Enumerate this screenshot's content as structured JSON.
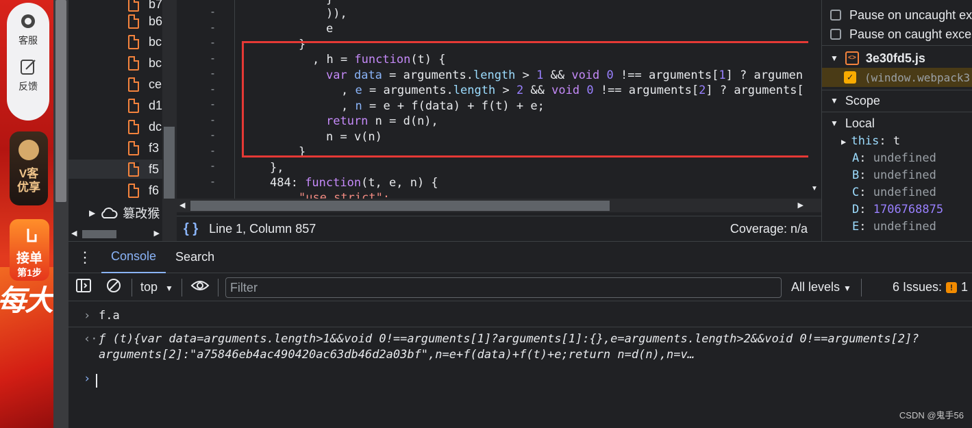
{
  "sidebar": {
    "service_label": "客服",
    "feedback_label": "反馈",
    "vip_label": "V客优享",
    "vip_line1": "V客",
    "vip_line2": "优享",
    "order_line1": "接单",
    "order_line2": "第1步",
    "promo_text": "每大"
  },
  "file_tree": {
    "files": [
      "b7",
      "b6",
      "bc",
      "bc",
      "ce",
      "d1",
      "dc",
      "f3",
      "f5",
      "f6"
    ],
    "folder_label": "篡改猴"
  },
  "editor": {
    "lines": [
      {
        "gutter": "",
        "text": "}"
      },
      {
        "gutter": "-",
        "text": ")),"
      },
      {
        "gutter": "-",
        "text": "e"
      },
      {
        "gutter": "-",
        "text": "}"
      },
      {
        "gutter": "-",
        "text": ", h = function(t) {"
      },
      {
        "gutter": "-",
        "text": "var data = arguments.length > 1 && void 0 !== arguments[1] ? argumen"
      },
      {
        "gutter": "-",
        "text": ", e = arguments.length > 2 && void 0 !== arguments[2] ? arguments["
      },
      {
        "gutter": "-",
        "text": ", n = e + f(data) + f(t) + e;"
      },
      {
        "gutter": "-",
        "text": "return n = d(n),"
      },
      {
        "gutter": "-",
        "text": "n = v(n)"
      },
      {
        "gutter": "-",
        "text": "}"
      },
      {
        "gutter": "-",
        "text": "},"
      },
      {
        "gutter": "-",
        "text": "484: function(t, e, n) {"
      },
      {
        "gutter": "",
        "text": "\"use strict\";"
      }
    ],
    "status_position": "Line 1, Column 857",
    "status_coverage": "Coverage: n/a",
    "braces_icon": "{ }"
  },
  "debugger": {
    "pause_uncaught": "Pause on uncaught ex",
    "pause_caught": "Pause on caught excep",
    "callstack_file": "3e30fd5.js",
    "callstack_frame": "(window.webpack3",
    "scope_label": "Scope",
    "local_label": "Local",
    "this_key": "this",
    "this_val": "t",
    "vars": [
      {
        "key": "A",
        "value": "undefined",
        "is_num": false
      },
      {
        "key": "B",
        "value": "undefined",
        "is_num": false
      },
      {
        "key": "C",
        "value": "undefined",
        "is_num": false
      },
      {
        "key": "D",
        "value": "1706768875",
        "is_num": true
      },
      {
        "key": "E",
        "value": "undefined",
        "is_num": false
      }
    ]
  },
  "drawer": {
    "tabs": [
      "Console",
      "Search"
    ],
    "active_tab": "Console",
    "context": "top",
    "filter_placeholder": "Filter",
    "levels": "All levels",
    "issues_label": "6 Issues:",
    "issues_count": "1"
  },
  "console": {
    "input_expr": "f.a",
    "output_line1": "ƒ (t){var data=arguments.length>1&&void 0!==arguments[1]?arguments[1]:{},e=arguments.length>2&&void 0!==arguments[2]?",
    "output_line2": "arguments[2]:\"a75846eb4ac490420ac63db46d2a03bf\",n=e+f(data)+f(t)+e;return n=d(n),n=v…"
  },
  "watermark": "CSDN @鬼手56",
  "colors": {
    "highlight_box": "#e53935",
    "accent": "#8ab4f8",
    "file_icon": "#f4833d"
  }
}
